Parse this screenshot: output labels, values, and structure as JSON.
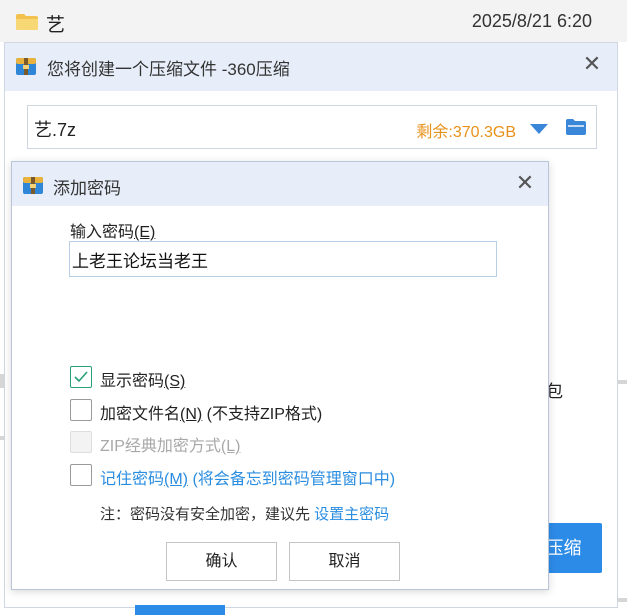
{
  "explorer": {
    "file_name": "艺",
    "file_date": "2025/8/21 6:20"
  },
  "main_dialog": {
    "title": "您将创建一个压缩文件 -360压缩",
    "path": "艺.7z",
    "free_space": "剩余:370.3GB",
    "side_text": "包",
    "compress_label": "压缩"
  },
  "password_dialog": {
    "title": "添加密码",
    "input_label": "输入密码",
    "input_label_key": "(E)",
    "password_value": "上老王论坛当老王",
    "options": {
      "show_password": {
        "label": "显示密码",
        "key": "(S)",
        "checked": true
      },
      "encrypt_filenames": {
        "label": "加密文件名",
        "key": "(N)",
        "suffix": " (不支持ZIP格式)",
        "checked": false
      },
      "zip_classic": {
        "label": "ZIP经典加密方式",
        "key": "(L)",
        "disabled": true
      },
      "remember": {
        "label": "记住密码",
        "key": "(M)",
        "suffix": " (将会备忘到密码管理窗口中)",
        "checked": false
      }
    },
    "note_prefix": "注：密码没有安全加密，建议先 ",
    "note_link": "设置主密码",
    "ok_label": "确认",
    "cancel_label": "取消"
  },
  "colors": {
    "accent": "#2b8de0",
    "free_space": "#e8911a",
    "check": "#2aa07a",
    "title_bar": "#e7eef9"
  },
  "icons": [
    "folder-icon",
    "archive-icon",
    "close-icon",
    "dropdown-arrow-icon",
    "browse-folder-icon",
    "check-icon"
  ]
}
